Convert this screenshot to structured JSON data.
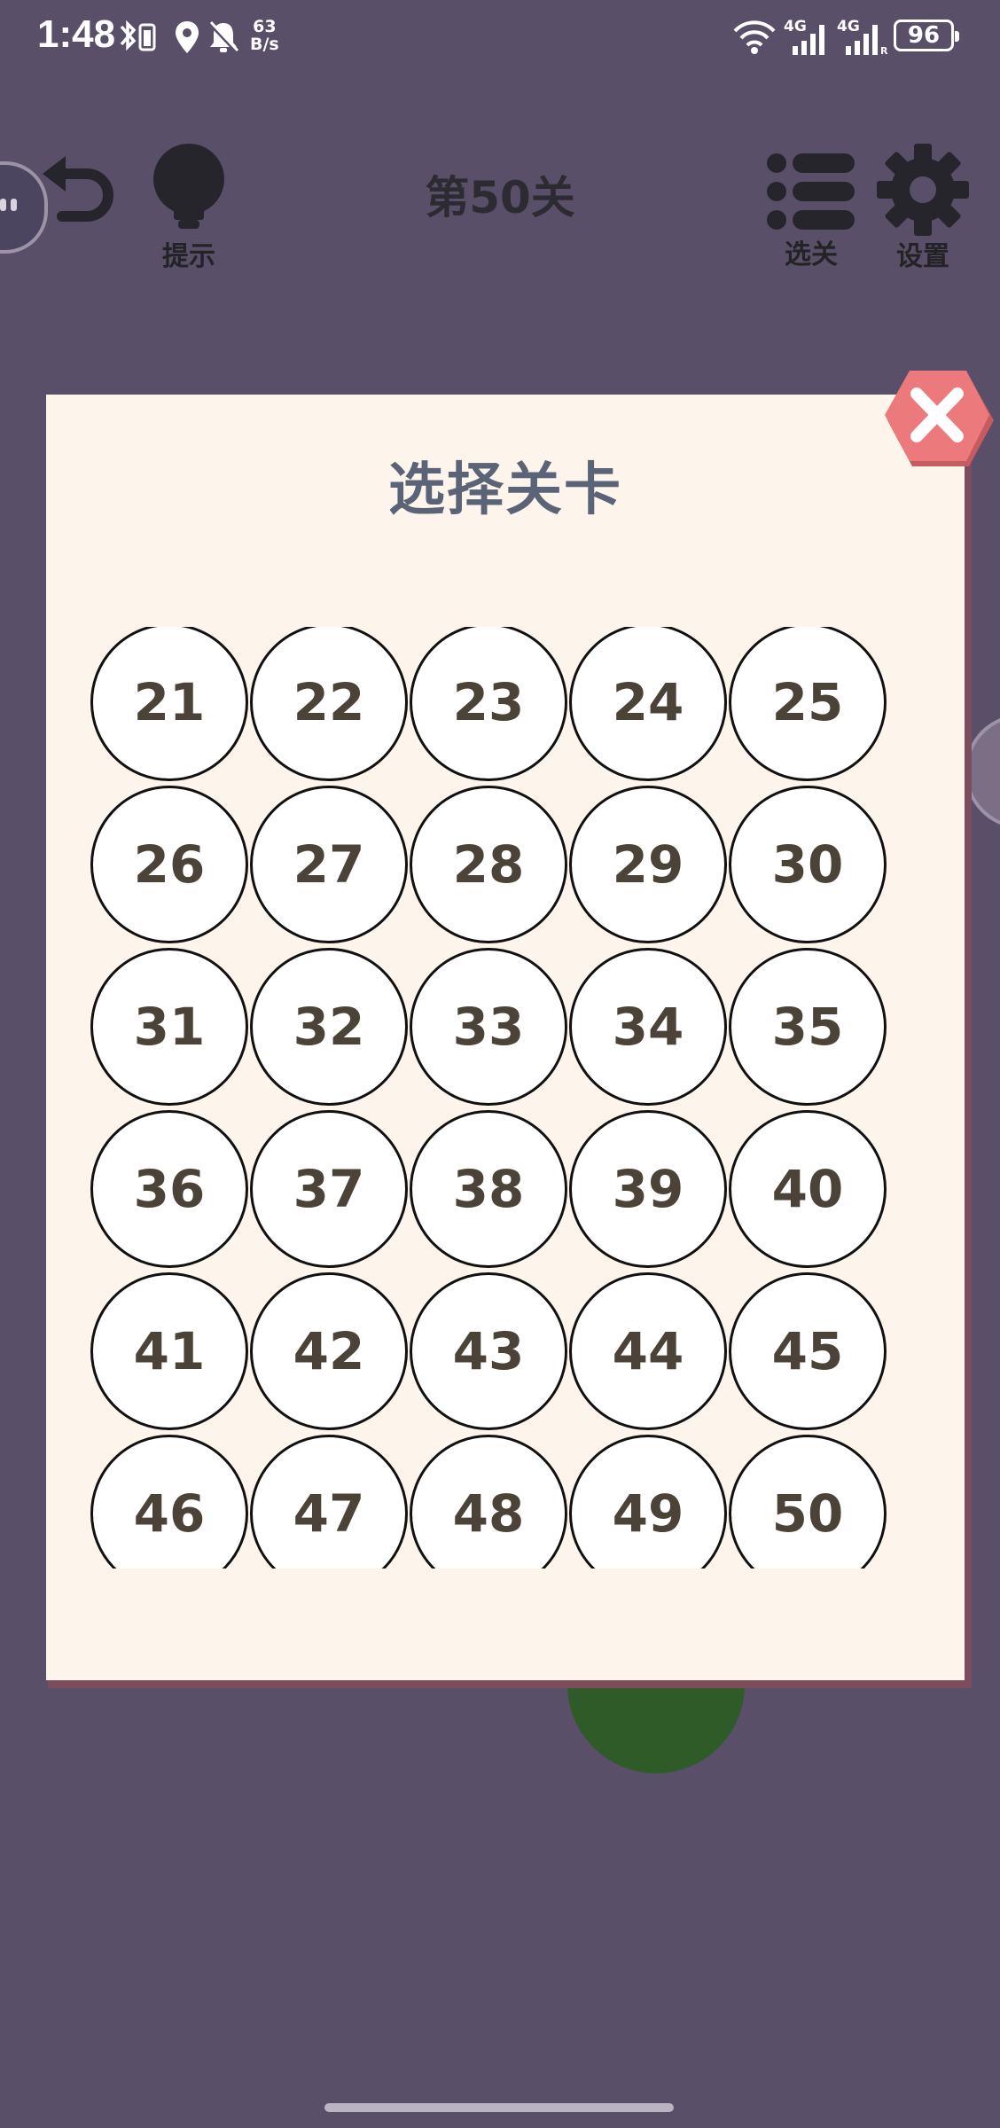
{
  "status_bar": {
    "time": "1:48",
    "net_speed_value": "63",
    "net_speed_unit": "B/s",
    "battery": "96",
    "signal_label_1": "4G",
    "signal_label_2": "4G"
  },
  "toolbar": {
    "hint_label": "提示",
    "level_title": "第50关",
    "select_label": "选关",
    "settings_label": "设置"
  },
  "dialog": {
    "title": "选择关卡",
    "levels": [
      "21",
      "22",
      "23",
      "24",
      "25",
      "26",
      "27",
      "28",
      "29",
      "30",
      "31",
      "32",
      "33",
      "34",
      "35",
      "36",
      "37",
      "38",
      "39",
      "40",
      "41",
      "42",
      "43",
      "44",
      "45",
      "46",
      "47",
      "48",
      "49",
      "50"
    ]
  },
  "colors": {
    "background": "#5a4f69",
    "dialog_bg": "#fdf4ec",
    "close_button": "#ec7a7d",
    "level_text": "#4c4338",
    "title_text": "#5b6476"
  }
}
